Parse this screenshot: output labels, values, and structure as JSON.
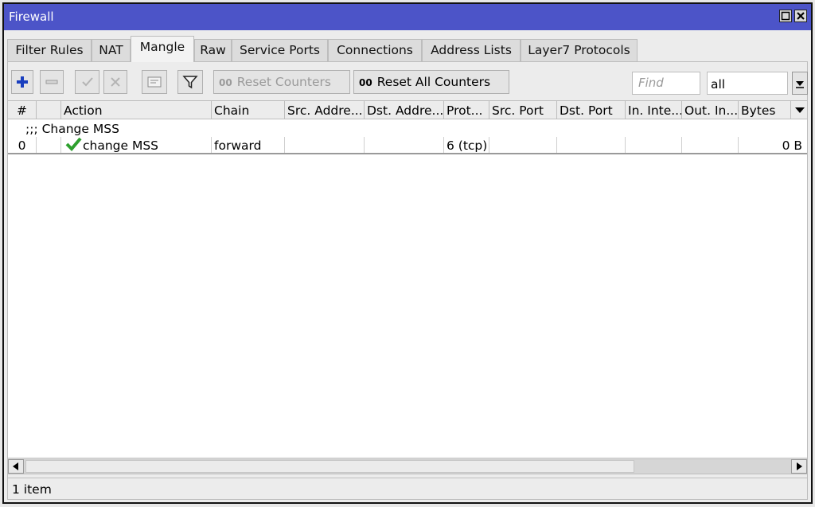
{
  "window": {
    "title": "Firewall"
  },
  "tabs": [
    {
      "label": "Filter Rules"
    },
    {
      "label": "NAT"
    },
    {
      "label": "Mangle",
      "active": true
    },
    {
      "label": "Raw"
    },
    {
      "label": "Service Ports"
    },
    {
      "label": "Connections"
    },
    {
      "label": "Address Lists"
    },
    {
      "label": "Layer7 Protocols"
    }
  ],
  "toolbar": {
    "add_icon": "plus-icon",
    "remove_icon": "minus-icon",
    "enable_icon": "check-icon",
    "disable_icon": "cross-icon",
    "comment_icon": "comment-icon",
    "filter_icon": "funnel-icon",
    "reset_counters_label": "Reset Counters",
    "reset_all_counters_label": "Reset All Counters",
    "oo": "00",
    "find_placeholder": "Find",
    "filter_value": "all"
  },
  "table": {
    "columns": [
      "#",
      "",
      "Action",
      "Chain",
      "Src. Addre...",
      "Dst. Addre...",
      "Prot...",
      "Src. Port",
      "Dst. Port",
      "In. Inte...",
      "Out. In...",
      "Bytes"
    ],
    "comment": ";;; Change MSS",
    "rows": [
      {
        "num": "0",
        "action": "change MSS",
        "chain": "forward",
        "src_address": "",
        "dst_address": "",
        "protocol": "6 (tcp)",
        "src_port": "",
        "dst_port": "",
        "in_interface": "",
        "out_interface": "",
        "bytes": "0 B"
      }
    ]
  },
  "status": {
    "text": "1 item"
  },
  "colors": {
    "titlebar": "#4c54c8",
    "add": "#1a3fbf",
    "enabled_check": "#2ea02e"
  }
}
